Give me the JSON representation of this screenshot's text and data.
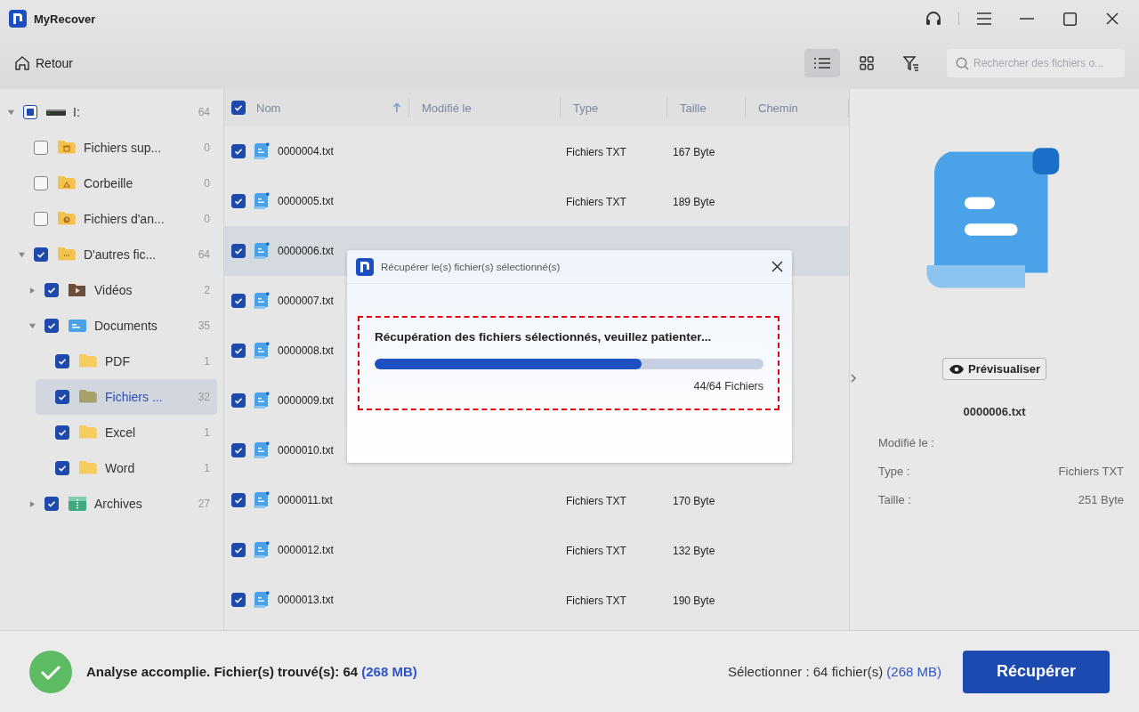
{
  "window": {
    "title": "MyRecover"
  },
  "toolbar": {
    "back": "Retour",
    "views": [
      {
        "kind": "list",
        "selected": true
      },
      {
        "kind": "grid",
        "selected": false
      },
      {
        "kind": "filter",
        "selected": false
      }
    ],
    "search": {
      "placeholder": "Rechercher des fichiers o..."
    }
  },
  "tree": [
    {
      "label": "I:",
      "count": "64",
      "kind": "drive",
      "checked": false,
      "partial": true,
      "selected": false,
      "expanded": true,
      "children": [
        {
          "label": "Fichiers sup...",
          "count": "0",
          "kind": "trash-folder",
          "checked": false,
          "partial": false,
          "selected": false
        },
        {
          "label": "Corbeille",
          "count": "0",
          "kind": "recycle-folder",
          "checked": false,
          "partial": false,
          "selected": false
        },
        {
          "label": "Fichiers d'an...",
          "count": "0",
          "kind": "clock-folder",
          "checked": false,
          "partial": false,
          "selected": false
        },
        {
          "label": "D'autres fic...",
          "count": "64",
          "kind": "other-folder",
          "checked": true,
          "partial": false,
          "selected": false,
          "expanded": true,
          "children": [
            {
              "label": "Vidéos",
              "count": "2",
              "kind": "video",
              "checked": true,
              "partial": false,
              "selected": false,
              "expanded": false
            },
            {
              "label": "Documents",
              "count": "35",
              "kind": "documents",
              "checked": true,
              "partial": false,
              "selected": false,
              "expanded": true,
              "children": [
                {
                  "label": "PDF",
                  "count": "1",
                  "kind": "folder",
                  "checked": true,
                  "partial": false,
                  "selected": false
                },
                {
                  "label": "Fichiers ...",
                  "count": "32",
                  "kind": "folder",
                  "checked": true,
                  "partial": false,
                  "selected": true
                },
                {
                  "label": "Excel",
                  "count": "1",
                  "kind": "folder",
                  "checked": true,
                  "partial": false,
                  "selected": false
                },
                {
                  "label": "Word",
                  "count": "1",
                  "kind": "folder",
                  "checked": true,
                  "partial": false,
                  "selected": false
                }
              ]
            },
            {
              "label": "Archives",
              "count": "27",
              "kind": "archive",
              "checked": true,
              "partial": false,
              "selected": false,
              "expanded": false
            }
          ]
        }
      ]
    }
  ],
  "table": {
    "all_checked": true,
    "columns": [
      {
        "label": "Nom",
        "sorted": true
      },
      {
        "label": "Modifié le",
        "sorted": false
      },
      {
        "label": "Type",
        "sorted": false
      },
      {
        "label": "Taille",
        "sorted": false
      },
      {
        "label": "Chemin",
        "sorted": false
      }
    ],
    "rows": [
      {
        "name": "0000004.txt",
        "type": "Fichiers TXT",
        "size": "167 Byte",
        "checked": true,
        "selected": false
      },
      {
        "name": "0000005.txt",
        "type": "Fichiers TXT",
        "size": "189 Byte",
        "checked": true,
        "selected": false
      },
      {
        "name": "0000006.txt",
        "checked": true,
        "selected": true
      },
      {
        "name": "0000007.txt",
        "checked": true,
        "selected": false
      },
      {
        "name": "0000008.txt",
        "checked": true,
        "selected": false
      },
      {
        "name": "0000009.txt",
        "checked": true,
        "selected": false
      },
      {
        "name": "0000010.txt",
        "checked": true,
        "selected": false
      },
      {
        "name": "0000011.txt",
        "type": "Fichiers TXT",
        "size": "170 Byte",
        "checked": true,
        "selected": false
      },
      {
        "name": "0000012.txt",
        "type": "Fichiers TXT",
        "size": "132 Byte",
        "checked": true,
        "selected": false
      },
      {
        "name": "0000013.txt",
        "type": "Fichiers TXT",
        "size": "190 Byte",
        "checked": true,
        "selected": false
      }
    ]
  },
  "preview": {
    "button": "Prévisualiser",
    "file_name": "0000006.txt",
    "details": [
      {
        "label": "Modifié le :"
      },
      {
        "label": "Type :",
        "value": "Fichiers TXT"
      },
      {
        "label": "Taille :",
        "value": "251 Byte"
      }
    ]
  },
  "dialog": {
    "title": "Récupérer le(s) fichier(s) sélectionné(s)",
    "message": "Récupération des fichiers sélectionnés, veuillez patienter...",
    "level": 0.6875,
    "progress_text": "44/64 Fichiers"
  },
  "status_bar": {
    "message": "Analyse accomplie. Fichier(s) trouvé(s): 64",
    "size": "(268 MB)",
    "selection": "Sélectionner : 64 fichier(s)",
    "selection_size": "(268 MB)",
    "button": "Récupérer"
  }
}
